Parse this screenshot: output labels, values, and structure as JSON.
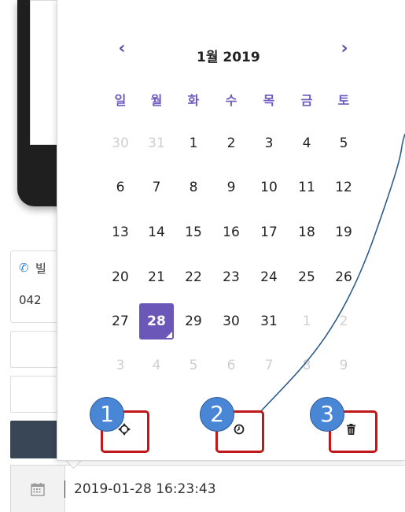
{
  "background": {
    "contact_label": "빌",
    "contact_number": "042"
  },
  "calendar": {
    "month_title": "1월 2019",
    "prev_symbol": "‹",
    "next_symbol": "›",
    "weekdays": [
      "일",
      "월",
      "화",
      "수",
      "목",
      "금",
      "토"
    ],
    "weeks": [
      [
        "30",
        "31",
        "1",
        "2",
        "3",
        "4",
        "5"
      ],
      [
        "6",
        "7",
        "8",
        "9",
        "10",
        "11",
        "12"
      ],
      [
        "13",
        "14",
        "15",
        "16",
        "17",
        "18",
        "19"
      ],
      [
        "20",
        "21",
        "22",
        "23",
        "24",
        "25",
        "26"
      ],
      [
        "27",
        "28",
        "29",
        "30",
        "31",
        "1",
        "2"
      ],
      [
        "3",
        "4",
        "5",
        "6",
        "7",
        "8",
        "9"
      ]
    ],
    "selected_day": "28"
  },
  "toolbar": {
    "icons": [
      "crosshair-icon",
      "clock-icon",
      "trash-icon"
    ]
  },
  "annotations": [
    "1",
    "2",
    "3"
  ],
  "datetime_field": {
    "value": "2019-01-28 16:23:43",
    "icon": "calendar-icon"
  },
  "colors": {
    "accent": "#6b57b8",
    "callout_red": "#c0171a",
    "badge_blue": "#4a86d6"
  }
}
